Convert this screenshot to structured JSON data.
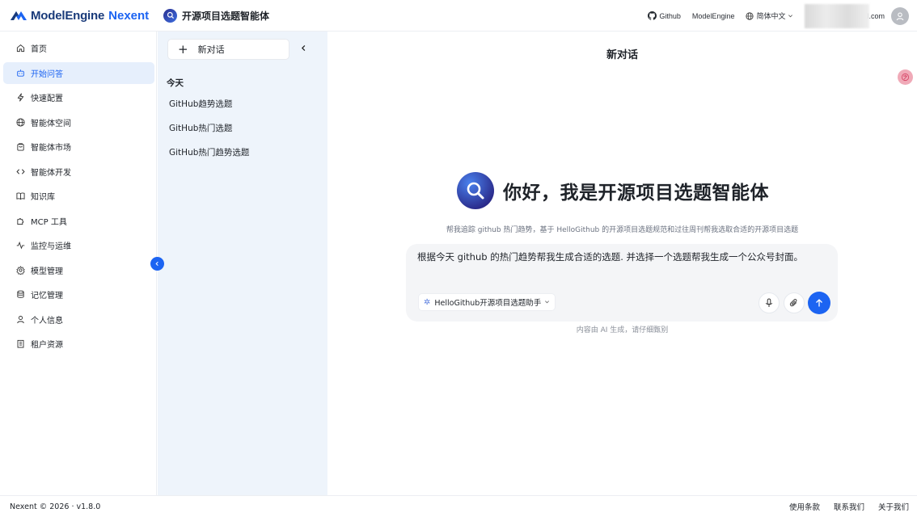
{
  "header": {
    "brand_name": "ModelEngine",
    "brand_sub": "Nexent",
    "agent_title": "开源项目选题智能体",
    "links": {
      "github": "Github",
      "model_engine": "ModelEngine",
      "language": "简体中文"
    },
    "email_suffix": "ail.com",
    "icons": [
      "github-icon",
      "globe-icon",
      "chevron-down-icon",
      "user-avatar-icon"
    ]
  },
  "sidebar": {
    "items": [
      {
        "label": "首页",
        "icon": "home-icon"
      },
      {
        "label": "开始问答",
        "icon": "chat-bot-icon",
        "active": true
      },
      {
        "label": "快速配置",
        "icon": "lightning-icon"
      },
      {
        "label": "智能体空间",
        "icon": "globe-icon"
      },
      {
        "label": "智能体市场",
        "icon": "store-icon"
      },
      {
        "label": "智能体开发",
        "icon": "code-icon"
      },
      {
        "label": "知识库",
        "icon": "book-icon"
      },
      {
        "label": "MCP 工具",
        "icon": "puzzle-icon"
      },
      {
        "label": "监控与运维",
        "icon": "pulse-icon"
      },
      {
        "label": "模型管理",
        "icon": "settings-icon"
      },
      {
        "label": "记忆管理",
        "icon": "database-icon"
      },
      {
        "label": "个人信息",
        "icon": "user-icon"
      },
      {
        "label": "租户资源",
        "icon": "building-icon"
      }
    ]
  },
  "history": {
    "new_chat_label": "新对话",
    "group_today": "今天",
    "items": [
      "GitHub趋势选题",
      "GitHub热门选题",
      "GitHub热门趋势选题"
    ]
  },
  "main": {
    "title": "新对话",
    "hero_title": "你好，我是开源项目选题智能体",
    "hero_subtitle": "帮我追踪 github 热门趋势，基于 HelloGithub 的开源项目选题规范和过往周刊帮我选取合适的开源项目选题",
    "composer_text": "根据今天 github 的热门趋势帮我生成合适的选题. 并选择一个选题帮我生成一个公众号封面。",
    "agent_select": "HelloGithub开源项目选题助手",
    "disclaimer": "内容由 AI 生成，请仔细甄别"
  },
  "footer": {
    "copyright": "Nexent © 2026 · v1.8.0",
    "links": [
      "使用条款",
      "联系我们",
      "关于我们"
    ]
  },
  "colors": {
    "accent": "#1c64f2",
    "active_bg": "#e6effc",
    "history_bg": "#eef4fb",
    "brand_dark": "#1a3b7a"
  }
}
